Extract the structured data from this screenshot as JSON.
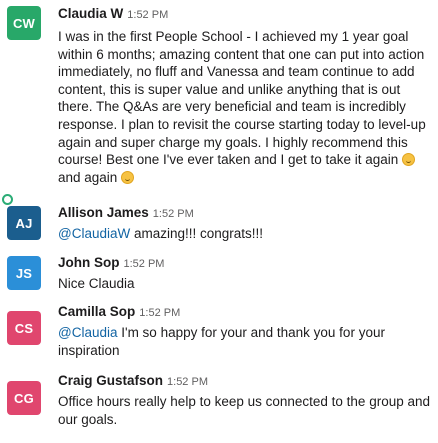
{
  "colors": {
    "cw": "#28a869",
    "aj": "#1b5e8e",
    "js": "#2b8fd8",
    "cs": "#e0466e",
    "cg": "#e0466e",
    "mention": "#1264a3"
  },
  "messages": [
    {
      "initials": "CW",
      "name": "Claudia W",
      "time": "1:52 PM",
      "text_before": "I was in the first People School - I achieved my 1 year goal within 6 months; amazing content that one can put into action immediately, no fluff and Vanessa and team continue to add content, this is super value and unlike anything that is out there. The Q&As are very beneficial and team is incredibly response. I plan to revisit the course starting today to level-up again and super charge my goals. I highly recommend this course! Best one I've ever taken and I get to take it again ",
      "text_mid": " and again ",
      "emoji": "slightly-smiling-face"
    },
    {
      "initials": "AJ",
      "name": "Allison James",
      "time": "1:52 PM",
      "mention": "@ClaudiaW",
      "text": " amazing!!! congrats!!!"
    },
    {
      "initials": "JS",
      "name": "John Sop",
      "time": "1:52 PM",
      "text": "Nice Claudia"
    },
    {
      "initials": "CS",
      "name": "Camilla Sop",
      "time": "1:52 PM",
      "mention": "@Claudia",
      "text": " I'm so happy for your and thank you for your inspiration"
    },
    {
      "initials": "CG",
      "name": "Craig Gustafson",
      "time": "1:52 PM",
      "text": "Office hours really help to keep us connected to the group and our goals."
    }
  ]
}
